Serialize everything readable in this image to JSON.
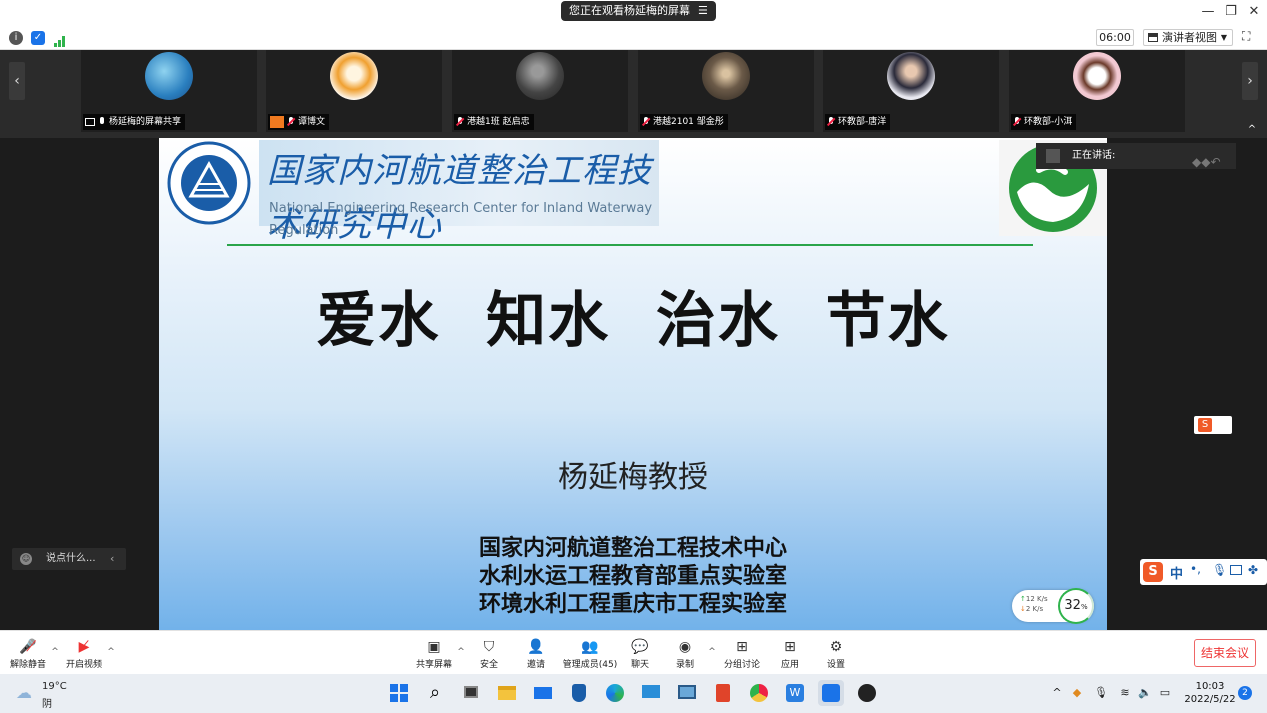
{
  "titlebar": {
    "share_notice": "您正在观看杨延梅的屏幕",
    "menu_icon": "list-icon",
    "minimize": "—",
    "restore": "❐",
    "close": "✕"
  },
  "infobar": {
    "timer": "06:00",
    "view_mode": "演讲者视图"
  },
  "participants": [
    {
      "name": "杨延梅的屏幕共享",
      "avatar_color": "#3a87c8"
    },
    {
      "name": "谭博文",
      "avatar_color": "#f0a030"
    },
    {
      "name": "港越1班 赵启忠",
      "avatar_color": "#555555"
    },
    {
      "name": "港越2101 邹金彤",
      "avatar_color": "#6b5a48"
    },
    {
      "name": "环教部-唐洋",
      "avatar_color": "#e8e8f0"
    },
    {
      "name": "环教部-小洱",
      "avatar_color": "#f2c9d2"
    }
  ],
  "slide": {
    "banner_cn": "国家内河航道整治工程技术研究中心",
    "banner_en": "National Engineering Research Center for Inland Waterway Regulation",
    "headline": "爱水  知水  治水  节水",
    "professor": "杨延梅教授",
    "orgs": [
      "国家内河航道整治工程技术中心",
      "水利水运工程教育部重点实验室",
      "环境水利工程重庆市工程实验室"
    ]
  },
  "overlays": {
    "speaking": "正在讲话:",
    "chat_placeholder": "说点什么...",
    "ime_lang": "中",
    "net_up": "12 K/s",
    "net_down": "2 K/s",
    "net_pct": "32"
  },
  "toolbar": {
    "unmute": "解除静音",
    "start_video": "开启视频",
    "share_screen": "共享屏幕",
    "security": "安全",
    "invite": "邀请",
    "members": "管理成员(45)",
    "chat": "聊天",
    "record": "录制",
    "breakout": "分组讨论",
    "apps": "应用",
    "settings": "设置",
    "end_meeting": "结束会议"
  },
  "taskbar": {
    "temperature": "19°C",
    "weather": "阴",
    "time": "10:03",
    "date": "2022/5/22",
    "notifications": "2"
  },
  "colors": {
    "accent_green": "#2aa44a",
    "slide_blue": "#72b2ea",
    "end_red": "#e33333"
  }
}
